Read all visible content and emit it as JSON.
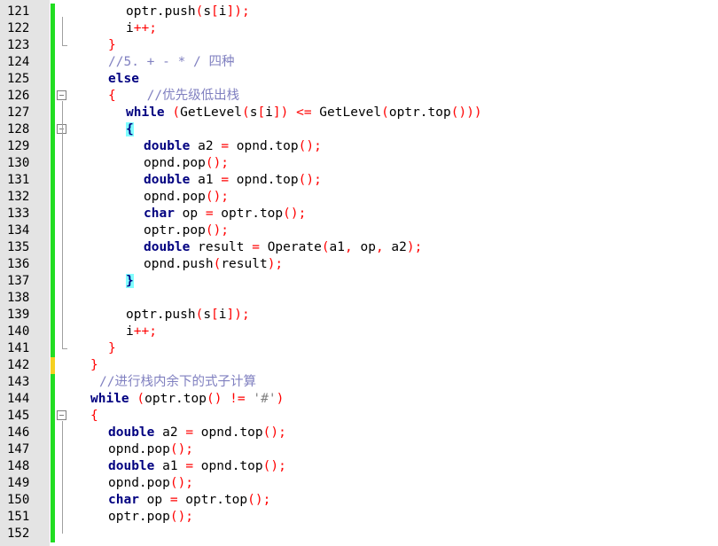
{
  "editor": {
    "colors": {
      "background": "#ffffff",
      "gutter": "#e4e4e4",
      "saved_change_bar": "#22dd22",
      "unsaved_change_bar": "#f5d020",
      "keyword": "#000080",
      "operator": "#ff0000",
      "comment": "#8080c0",
      "brace_match_highlight": "#80ffff"
    },
    "lines": [
      {
        "num": "121",
        "indent": 6,
        "tokens": [
          {
            "t": "optr.push",
            "c": "id"
          },
          {
            "t": "(",
            "c": "op"
          },
          {
            "t": "s",
            "c": "id"
          },
          {
            "t": "[",
            "c": "op"
          },
          {
            "t": "i",
            "c": "id"
          },
          {
            "t": "]);",
            "c": "op"
          }
        ]
      },
      {
        "num": "122",
        "indent": 6,
        "tokens": [
          {
            "t": "i",
            "c": "id"
          },
          {
            "t": "++;",
            "c": "op"
          }
        ]
      },
      {
        "num": "123",
        "indent": 4,
        "tokens": [
          {
            "t": "}",
            "c": "op"
          }
        ]
      },
      {
        "num": "124",
        "indent": 4,
        "tokens": [
          {
            "t": "//5. + - * / 四种",
            "c": "cm"
          }
        ]
      },
      {
        "num": "125",
        "indent": 4,
        "tokens": [
          {
            "t": "else",
            "c": "kw"
          }
        ]
      },
      {
        "num": "126",
        "indent": 4,
        "tokens": [
          {
            "t": "{",
            "c": "op"
          },
          {
            "t": "    //优先级低出栈",
            "c": "cm"
          }
        ]
      },
      {
        "num": "127",
        "indent": 6,
        "tokens": [
          {
            "t": "while",
            "c": "kw"
          },
          {
            "t": " ",
            "c": "id"
          },
          {
            "t": "(",
            "c": "op"
          },
          {
            "t": "GetLevel",
            "c": "id"
          },
          {
            "t": "(",
            "c": "op"
          },
          {
            "t": "s",
            "c": "id"
          },
          {
            "t": "[",
            "c": "op"
          },
          {
            "t": "i",
            "c": "id"
          },
          {
            "t": "])",
            "c": "op"
          },
          {
            "t": " ",
            "c": "id"
          },
          {
            "t": "<=",
            "c": "op"
          },
          {
            "t": " GetLevel",
            "c": "id"
          },
          {
            "t": "(",
            "c": "op"
          },
          {
            "t": "optr.top",
            "c": "id"
          },
          {
            "t": "()))",
            "c": "op"
          }
        ]
      },
      {
        "num": "128",
        "indent": 6,
        "tokens": [
          {
            "t": "{",
            "c": "hl"
          }
        ]
      },
      {
        "num": "129",
        "indent": 8,
        "tokens": [
          {
            "t": "double",
            "c": "kw"
          },
          {
            "t": " a2 ",
            "c": "id"
          },
          {
            "t": "=",
            "c": "op"
          },
          {
            "t": " opnd.top",
            "c": "id"
          },
          {
            "t": "();",
            "c": "op"
          }
        ]
      },
      {
        "num": "130",
        "indent": 8,
        "tokens": [
          {
            "t": "opnd.pop",
            "c": "id"
          },
          {
            "t": "();",
            "c": "op"
          }
        ]
      },
      {
        "num": "131",
        "indent": 8,
        "tokens": [
          {
            "t": "double",
            "c": "kw"
          },
          {
            "t": " a1 ",
            "c": "id"
          },
          {
            "t": "=",
            "c": "op"
          },
          {
            "t": " opnd.top",
            "c": "id"
          },
          {
            "t": "();",
            "c": "op"
          }
        ]
      },
      {
        "num": "132",
        "indent": 8,
        "tokens": [
          {
            "t": "opnd.pop",
            "c": "id"
          },
          {
            "t": "();",
            "c": "op"
          }
        ]
      },
      {
        "num": "133",
        "indent": 8,
        "tokens": [
          {
            "t": "char",
            "c": "kw"
          },
          {
            "t": " op ",
            "c": "id"
          },
          {
            "t": "=",
            "c": "op"
          },
          {
            "t": " optr.top",
            "c": "id"
          },
          {
            "t": "();",
            "c": "op"
          }
        ]
      },
      {
        "num": "134",
        "indent": 8,
        "tokens": [
          {
            "t": "optr.pop",
            "c": "id"
          },
          {
            "t": "();",
            "c": "op"
          }
        ]
      },
      {
        "num": "135",
        "indent": 8,
        "tokens": [
          {
            "t": "double",
            "c": "kw"
          },
          {
            "t": " result ",
            "c": "id"
          },
          {
            "t": "=",
            "c": "op"
          },
          {
            "t": " Operate",
            "c": "id"
          },
          {
            "t": "(",
            "c": "op"
          },
          {
            "t": "a1",
            "c": "id"
          },
          {
            "t": ",",
            "c": "op"
          },
          {
            "t": " op",
            "c": "id"
          },
          {
            "t": ",",
            "c": "op"
          },
          {
            "t": " a2",
            "c": "id"
          },
          {
            "t": ");",
            "c": "op"
          }
        ]
      },
      {
        "num": "136",
        "indent": 8,
        "tokens": [
          {
            "t": "opnd.push",
            "c": "id"
          },
          {
            "t": "(",
            "c": "op"
          },
          {
            "t": "result",
            "c": "id"
          },
          {
            "t": ");",
            "c": "op"
          }
        ]
      },
      {
        "num": "137",
        "indent": 6,
        "tokens": [
          {
            "t": "}",
            "c": "hl"
          }
        ]
      },
      {
        "num": "138",
        "indent": 0,
        "tokens": []
      },
      {
        "num": "139",
        "indent": 6,
        "tokens": [
          {
            "t": "optr.push",
            "c": "id"
          },
          {
            "t": "(",
            "c": "op"
          },
          {
            "t": "s",
            "c": "id"
          },
          {
            "t": "[",
            "c": "op"
          },
          {
            "t": "i",
            "c": "id"
          },
          {
            "t": "]);",
            "c": "op"
          }
        ]
      },
      {
        "num": "140",
        "indent": 6,
        "tokens": [
          {
            "t": "i",
            "c": "id"
          },
          {
            "t": "++;",
            "c": "op"
          }
        ]
      },
      {
        "num": "141",
        "indent": 4,
        "tokens": [
          {
            "t": "}",
            "c": "op"
          }
        ]
      },
      {
        "num": "142",
        "indent": 2,
        "tokens": [
          {
            "t": "}",
            "c": "op"
          }
        ]
      },
      {
        "num": "143",
        "indent": 3,
        "tokens": [
          {
            "t": "//进行栈内余下的式子计算",
            "c": "cm"
          }
        ]
      },
      {
        "num": "144",
        "indent": 2,
        "tokens": [
          {
            "t": "while",
            "c": "kw"
          },
          {
            "t": " ",
            "c": "id"
          },
          {
            "t": "(",
            "c": "op"
          },
          {
            "t": "optr.top",
            "c": "id"
          },
          {
            "t": "()",
            "c": "op"
          },
          {
            "t": " ",
            "c": "id"
          },
          {
            "t": "!=",
            "c": "op"
          },
          {
            "t": " ",
            "c": "id"
          },
          {
            "t": "'#'",
            "c": "str"
          },
          {
            "t": ")",
            "c": "op"
          }
        ]
      },
      {
        "num": "145",
        "indent": 2,
        "tokens": [
          {
            "t": "{",
            "c": "op"
          }
        ]
      },
      {
        "num": "146",
        "indent": 4,
        "tokens": [
          {
            "t": "double",
            "c": "kw"
          },
          {
            "t": " a2 ",
            "c": "id"
          },
          {
            "t": "=",
            "c": "op"
          },
          {
            "t": " opnd.top",
            "c": "id"
          },
          {
            "t": "();",
            "c": "op"
          }
        ]
      },
      {
        "num": "147",
        "indent": 4,
        "tokens": [
          {
            "t": "opnd.pop",
            "c": "id"
          },
          {
            "t": "();",
            "c": "op"
          }
        ]
      },
      {
        "num": "148",
        "indent": 4,
        "tokens": [
          {
            "t": "double",
            "c": "kw"
          },
          {
            "t": " a1 ",
            "c": "id"
          },
          {
            "t": "=",
            "c": "op"
          },
          {
            "t": " opnd.top",
            "c": "id"
          },
          {
            "t": "();",
            "c": "op"
          }
        ]
      },
      {
        "num": "149",
        "indent": 4,
        "tokens": [
          {
            "t": "opnd.pop",
            "c": "id"
          },
          {
            "t": "();",
            "c": "op"
          }
        ]
      },
      {
        "num": "150",
        "indent": 4,
        "tokens": [
          {
            "t": "char",
            "c": "kw"
          },
          {
            "t": " op ",
            "c": "id"
          },
          {
            "t": "=",
            "c": "op"
          },
          {
            "t": " optr.top",
            "c": "id"
          },
          {
            "t": "();",
            "c": "op"
          }
        ]
      },
      {
        "num": "151",
        "indent": 4,
        "tokens": [
          {
            "t": "optr.pop",
            "c": "id"
          },
          {
            "t": "();",
            "c": "op"
          }
        ]
      },
      {
        "num": "152",
        "indent": 0,
        "tokens": []
      }
    ],
    "fold_markers": [
      "126",
      "128",
      "145"
    ],
    "fold_ends": [
      "123",
      "141"
    ],
    "unsaved_lines": [
      "142"
    ]
  }
}
